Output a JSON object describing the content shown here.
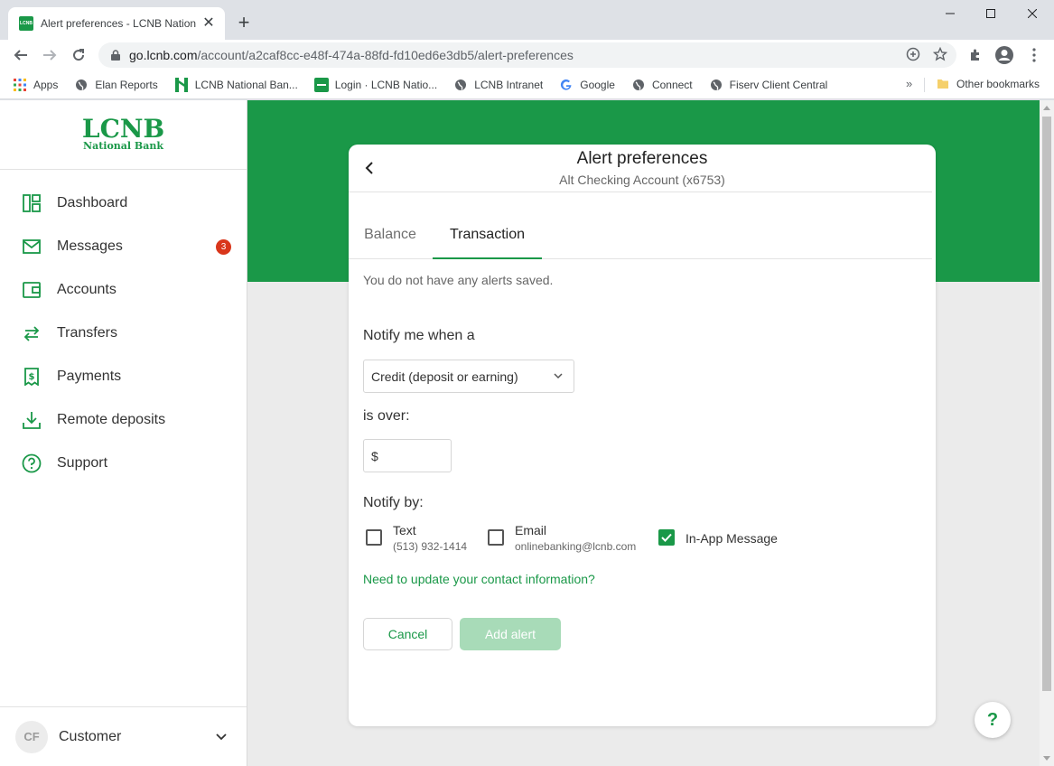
{
  "browser": {
    "tab_title": "Alert preferences - LCNB National Bank",
    "tab_favicon_text": "LCNB",
    "url_host": "go.lcnb.com",
    "url_path": "/account/a2caf8cc-e48f-474a-88fd-fd10ed6e3db5/alert-preferences",
    "bookmarks": [
      {
        "label": "Apps",
        "icon": "apps-grid-icon"
      },
      {
        "label": "Elan Reports",
        "icon": "globe-icon"
      },
      {
        "label": "LCNB National Ban...",
        "icon": "lcnb-favicon-icon"
      },
      {
        "label": "Login · LCNB Natio...",
        "icon": "lcnb-favicon-icon"
      },
      {
        "label": "LCNB Intranet",
        "icon": "globe-icon"
      },
      {
        "label": "Google",
        "icon": "google-icon"
      },
      {
        "label": "Connect",
        "icon": "globe-icon"
      },
      {
        "label": "Fiserv Client Central",
        "icon": "globe-icon"
      }
    ],
    "bookmarks_overflow": "»",
    "other_bookmarks": "Other bookmarks"
  },
  "sidebar": {
    "logo_main": "LCNB",
    "logo_sub": "National Bank",
    "items": [
      {
        "label": "Dashboard",
        "icon": "dashboard-icon"
      },
      {
        "label": "Messages",
        "icon": "mail-icon",
        "badge": "3"
      },
      {
        "label": "Accounts",
        "icon": "wallet-icon"
      },
      {
        "label": "Transfers",
        "icon": "transfer-icon"
      },
      {
        "label": "Payments",
        "icon": "payment-icon"
      },
      {
        "label": "Remote deposits",
        "icon": "download-icon"
      },
      {
        "label": "Support",
        "icon": "help-circle-icon"
      }
    ],
    "user": {
      "initials": "CF",
      "name": "Customer"
    }
  },
  "card": {
    "title": "Alert preferences",
    "subtitle": "Alt Checking Account (x6753)",
    "tabs": [
      "Balance",
      "Transaction"
    ],
    "active_tab": "Transaction",
    "empty_message": "You do not have any alerts saved.",
    "notify_label": "Notify me when a",
    "select_value": "Credit (deposit or earning)",
    "over_label": "is over:",
    "amount_prefix": "$",
    "notify_by_label": "Notify by:",
    "options": [
      {
        "label": "Text",
        "detail": "(513) 932-1414",
        "checked": false
      },
      {
        "label": "Email",
        "detail": "onlinebanking@lcnb.com",
        "checked": false
      },
      {
        "label": "In-App Message",
        "detail": "",
        "checked": true
      }
    ],
    "contact_link": "Need to update your contact information?",
    "cancel_label": "Cancel",
    "add_label": "Add alert"
  },
  "help_label": "?",
  "colors": {
    "brand_green": "#1a9848",
    "badge_red": "#d9361b",
    "disabled_green": "#a8dbb8"
  }
}
